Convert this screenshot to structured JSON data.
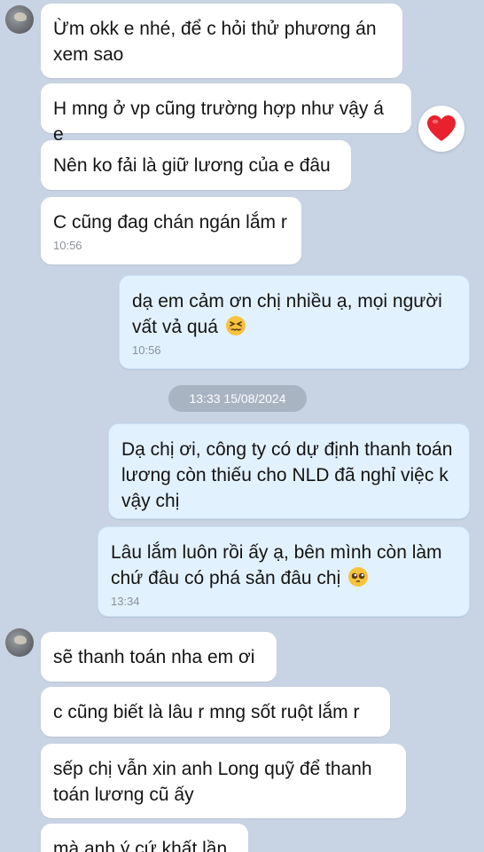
{
  "messages": [
    {
      "text": "Ừm okk e nhé, để c hỏi thử phương án xem sao"
    },
    {
      "text": "H mng ở vp cũng trường hợp như vậy á e",
      "reaction": "heart"
    },
    {
      "text": "Nên ko fải là giữ lương của e đâu"
    },
    {
      "text": "C cũng đag chán ngán lắm r",
      "time": "10:56"
    },
    {
      "text": "dạ em cảm ơn chị nhiều ạ, mọi người vất vả quá",
      "time": "10:56",
      "emoji": "persevering-face"
    },
    {
      "text": "Dạ chị ơi, công ty có dự định thanh toán lương còn thiếu cho NLD đã nghỉ việc k vậy chị"
    },
    {
      "text": "Lâu lắm luôn rồi ấy ạ, bên mình còn làm chứ đâu có phá sản đâu chị",
      "time": "13:34",
      "emoji": "pleading-face"
    },
    {
      "text": "sẽ thanh toán nha em ơi"
    },
    {
      "text": "c cũng biết là lâu r mng sốt ruột lắm r"
    },
    {
      "text": "sếp chị vẫn xin anh Long quỹ để thanh toán lương cũ ấy"
    },
    {
      "text": "mà anh ý cứ khất lần"
    }
  ],
  "date_separator": "13:33 15/08/2024",
  "colors": {
    "background": "#c8d3e3",
    "incoming_bubble": "#ffffff",
    "outgoing_bubble": "#e2f1fe",
    "reaction": "#e8212e"
  }
}
